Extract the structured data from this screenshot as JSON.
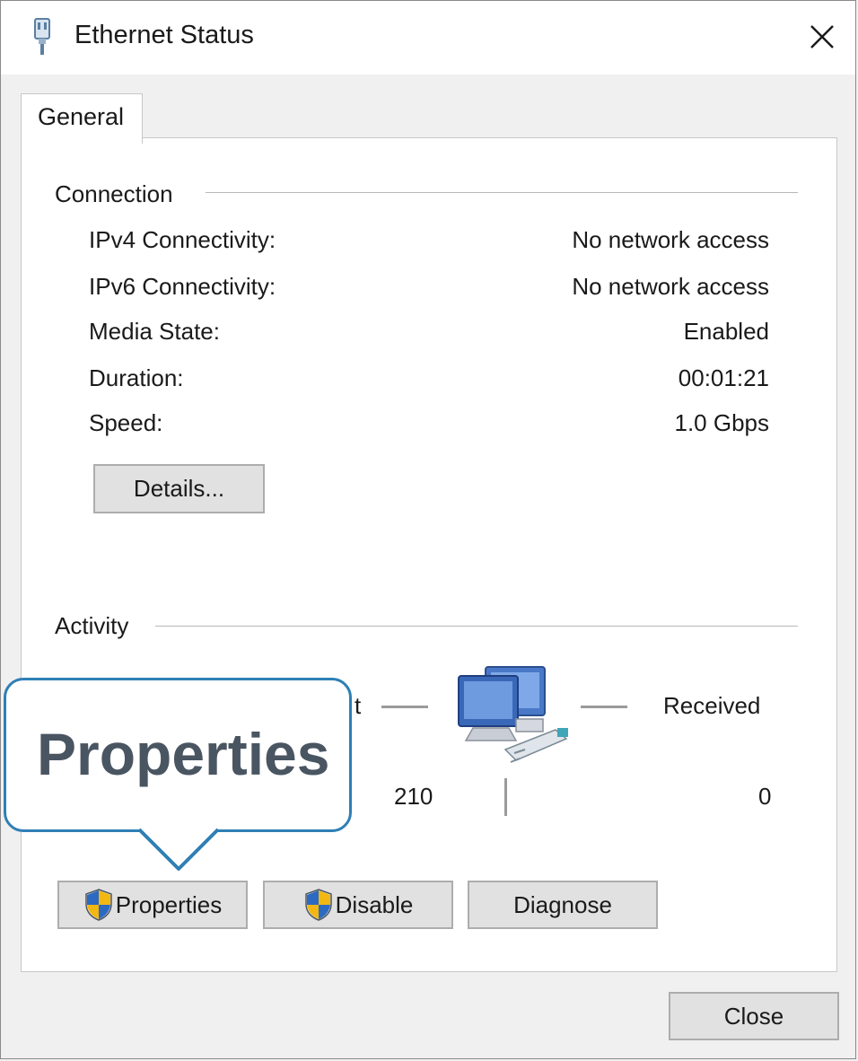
{
  "window": {
    "title": "Ethernet Status"
  },
  "tabs": [
    {
      "label": "General"
    }
  ],
  "connection": {
    "label": "Connection",
    "rows": [
      {
        "label": "IPv4 Connectivity:",
        "value": "No network access"
      },
      {
        "label": "IPv6 Connectivity:",
        "value": "No network access"
      },
      {
        "label": "Media State:",
        "value": "Enabled"
      },
      {
        "label": "Duration:",
        "value": "00:01:21"
      },
      {
        "label": "Speed:",
        "value": "1.0 Gbps"
      }
    ],
    "details_button": "Details..."
  },
  "activity": {
    "label": "Activity",
    "sent_partial": "t",
    "received_label": "Received",
    "sent_value": "210",
    "received_value": "0"
  },
  "callout": {
    "text": "Properties"
  },
  "buttons": {
    "properties": "Properties",
    "disable": "Disable",
    "diagnose": "Diagnose",
    "close": "Close"
  },
  "icons": {
    "title": "ethernet-plug-icon",
    "network": "network-computers-icon",
    "shield": "uac-shield-icon",
    "close": "close-icon"
  },
  "colors": {
    "callout_border": "#2f7fb5",
    "callout_text": "#4a5562",
    "button_face": "#e1e1e1"
  }
}
